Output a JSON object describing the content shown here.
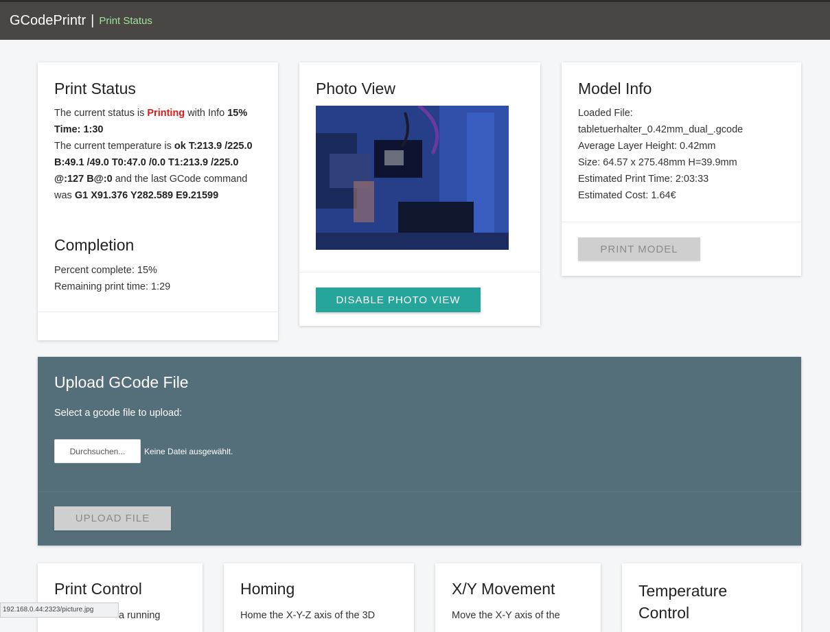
{
  "app": {
    "title": "GCodePrintr",
    "separator": "|",
    "breadcrumb": "Print Status"
  },
  "print_status": {
    "title": "Print Status",
    "line1_a": "The current status is ",
    "status_value": "Printing",
    "line1_b": " with Info",
    "info": "15% Time: 1:30",
    "temp_prefix": "The current temperature is ",
    "temp_value": "ok T:213.9 /225.0 B:49.1 /49.0 T0:47.0 /0.0 T1:213.9 /225.0 @:127 B@:0",
    "gcode_prefix": " and the last GCode command was ",
    "gcode_value": "G1 X91.376 Y282.589 E9.21599",
    "completion_title": "Completion",
    "percent_line": "Percent complete: 15%",
    "remaining_line": "Remaining print time: 1:29",
    "status_color": "#e01818"
  },
  "photo_view": {
    "title": "Photo View",
    "disable_button": "DISABLE PHOTO VIEW",
    "accent_color": "#26a69a"
  },
  "model_info": {
    "title": "Model Info",
    "loaded_label": "Loaded File:",
    "file_name": "tabletuerhalter_0.42mm_dual_.gcode",
    "layer_height": "Average Layer Height: 0.42mm",
    "size": "Size: 64.57 x 275.48mm H=39.9mm",
    "print_time": "Estimated Print Time: 2:03:33",
    "cost": "Estimated Cost: 1.64€",
    "print_button": "PRINT MODEL"
  },
  "upload": {
    "title": "Upload GCode File",
    "label": "Select a gcode file to upload:",
    "browse_button": "Durchsuchen...",
    "no_file": "Keine Datei ausgewählt.",
    "upload_button": "UPLOAD FILE",
    "background_color": "#546e7a"
  },
  "bottom_cards": {
    "print_control": {
      "title": "Print Control",
      "text": "a running"
    },
    "homing": {
      "title": "Homing",
      "text": "Home the X-Y-Z axis of the 3D"
    },
    "xy_movement": {
      "title": "X/Y Movement",
      "text": "Move the X-Y axis of the"
    },
    "temperature": {
      "title_line1": "Temperature",
      "title_line2": "Control"
    }
  },
  "status_bar": {
    "url": "192.168.0.44:2323/picture.jpg"
  }
}
